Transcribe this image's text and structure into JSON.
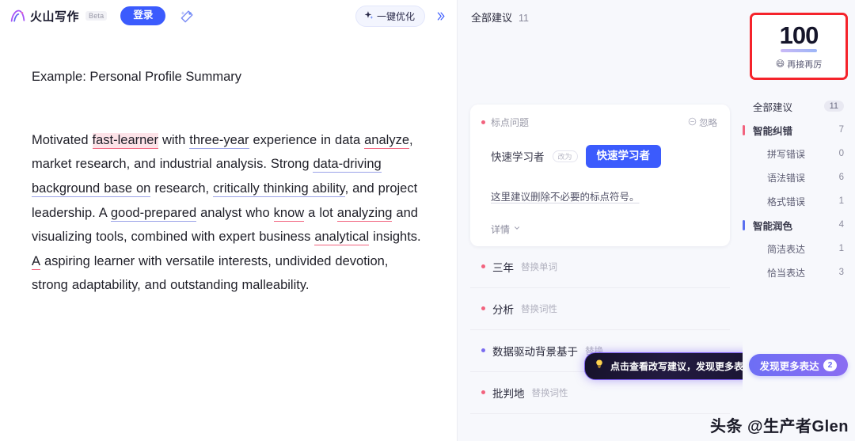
{
  "topbar": {
    "brand_name": "火山写作",
    "beta_label": "Beta",
    "login_label": "登录",
    "wand_icon": "magic-wand-icon",
    "optimize_label": "一键优化",
    "optimize_icon": "sparkle-icon",
    "expand_label": "»"
  },
  "editor": {
    "title": "Example: Personal Profile Summary",
    "paragraph": {
      "s1": "Motivated ",
      "m1": "fast-learner",
      "s2": " with ",
      "m2": "three-year",
      "s3": " experience in data ",
      "m3": "analyze",
      "s4": ", market research, and industrial analysis. Strong ",
      "m4": "data-driving background base on",
      "s5": " research, ",
      "m5": "critically thinking ability",
      "s6": ", and project leadership. A ",
      "m6": "good-prepared",
      "s7": " analyst who ",
      "m7": "know",
      "s8": " a lot ",
      "m8": "analyzing",
      "s9": " and visualizing tools, combined with expert business ",
      "m9": "analytical",
      "s10": " insights. ",
      "m10": "A",
      "s11": " aspiring learner with versatile interests, undivided devotion, strong adaptability, and outstanding malleability."
    }
  },
  "middle": {
    "header_title": "全部建议",
    "header_count": "11",
    "card": {
      "tag": "标点问题",
      "ignore_label": "忽略",
      "ignore_icon": "minus-circle-icon",
      "original": "快速学习者",
      "arrow": "改为",
      "fixed": "快速学习者",
      "explanation": "这里建议删除不必要的标点符号。",
      "detail_label": "详情",
      "detail_icon": "chevron-down-icon"
    },
    "suggestions": [
      {
        "word": "三年",
        "kind": "替换单词",
        "dot": "red"
      },
      {
        "word": "分析",
        "kind": "替换词性",
        "dot": "red"
      },
      {
        "word": "数据驱动背景基于",
        "kind": "替换",
        "dot": "purple"
      },
      {
        "word": "批判地",
        "kind": "替换词性",
        "dot": "red"
      }
    ],
    "tooltip": {
      "icon": "lightbulb-icon",
      "text": "点击查看改写建议，发现更多表达"
    }
  },
  "sidebar": {
    "score": {
      "value": "100",
      "emoji": "😄",
      "caption": "再接再厉"
    },
    "rows": [
      {
        "label": "全部建议",
        "count": "11",
        "bar": "none",
        "level": "all"
      },
      {
        "label": "智能纠错",
        "count": "7",
        "bar": "red",
        "level": "head"
      },
      {
        "label": "拼写错误",
        "count": "0",
        "bar": "none",
        "level": "sub"
      },
      {
        "label": "语法错误",
        "count": "6",
        "bar": "none",
        "level": "sub"
      },
      {
        "label": "格式错误",
        "count": "1",
        "bar": "none",
        "level": "sub"
      },
      {
        "label": "智能润色",
        "count": "4",
        "bar": "purple",
        "level": "head"
      },
      {
        "label": "简洁表达",
        "count": "1",
        "bar": "none",
        "level": "sub"
      },
      {
        "label": "恰当表达",
        "count": "3",
        "bar": "none",
        "level": "sub"
      }
    ],
    "more_button": {
      "label": "发现更多表达",
      "count": "2"
    }
  },
  "watermark": "头条 @生产者Glen",
  "colors": {
    "accent_blue": "#3b5bfd",
    "error_red": "#f2637e",
    "polish_purple": "#5a6ff0",
    "score_border": "#f5232b"
  }
}
